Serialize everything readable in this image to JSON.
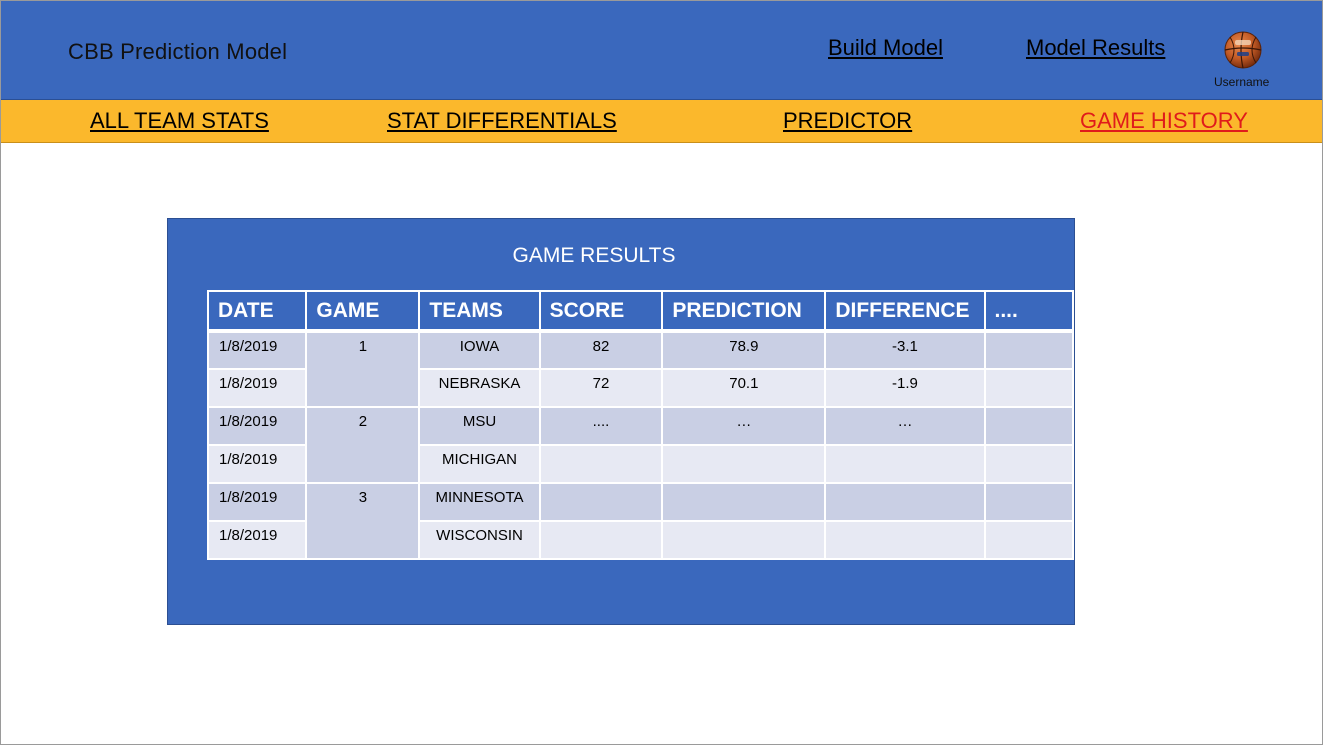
{
  "header": {
    "app_title": "CBB Prediction Model",
    "links": {
      "build_model": "Build Model",
      "model_results": "Model Results"
    },
    "user": {
      "username": "Username",
      "avatar_icon": "basketball-icon"
    }
  },
  "subnav": {
    "all_team_stats": "ALL TEAM STATS",
    "stat_differentials": "STAT DIFFERENTIALS",
    "predictor": "PREDICTOR",
    "game_history": "GAME HISTORY",
    "active": "game_history"
  },
  "results": {
    "title": "GAME RESULTS",
    "columns": [
      "DATE",
      "GAME",
      "TEAMS",
      "SCORE",
      "PREDICTION",
      "DIFFERENCE",
      "...."
    ],
    "games": [
      {
        "game": "1",
        "rows": [
          {
            "date": "1/8/2019",
            "team": "IOWA",
            "score": "82",
            "prediction": "78.9",
            "difference": "-3.1",
            "more": ""
          },
          {
            "date": "1/8/2019",
            "team": "NEBRASKA",
            "score": "72",
            "prediction": "70.1",
            "difference": "-1.9",
            "more": ""
          }
        ]
      },
      {
        "game": "2",
        "rows": [
          {
            "date": "1/8/2019",
            "team": "MSU",
            "score": "....",
            "prediction": "…",
            "difference": "…",
            "more": ""
          },
          {
            "date": "1/8/2019",
            "team": "MICHIGAN",
            "score": "",
            "prediction": "",
            "difference": "",
            "more": ""
          }
        ]
      },
      {
        "game": "3",
        "rows": [
          {
            "date": "1/8/2019",
            "team": "MINNESOTA",
            "score": "",
            "prediction": "",
            "difference": "",
            "more": ""
          },
          {
            "date": "1/8/2019",
            "team": "WISCONSIN",
            "score": "",
            "prediction": "",
            "difference": "",
            "more": ""
          }
        ]
      }
    ]
  },
  "colors": {
    "header_blue": "#3a68bd",
    "subnav_gold": "#fbb82c",
    "active_link_red": "#e01b1b",
    "row_dark": "#c9cfe4",
    "row_light": "#e7e9f3"
  }
}
